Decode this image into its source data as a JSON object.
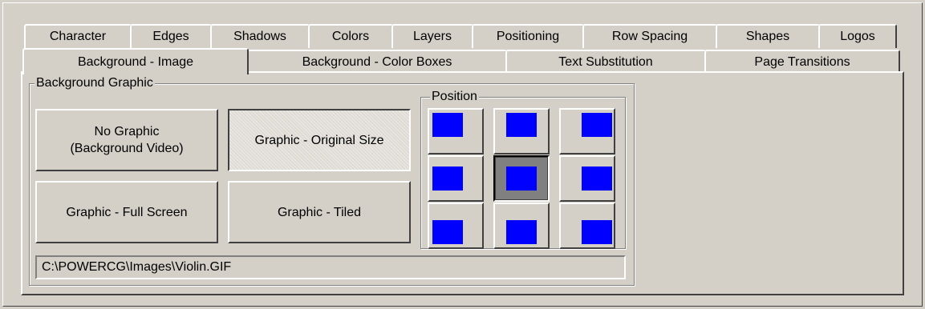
{
  "tabs_row1": [
    "Character",
    "Edges",
    "Shadows",
    "Colors",
    "Layers",
    "Positioning",
    "Row Spacing",
    "Shapes",
    "Logos"
  ],
  "tabs_row2": [
    "Background - Image",
    "Background - Color Boxes",
    "Text Substitution",
    "Page Transitions"
  ],
  "selected_tab": "Background - Image",
  "background_graphic": {
    "group_label": "Background Graphic",
    "buttons": {
      "no_graphic": "No Graphic\n(Background Video)",
      "original_size": "Graphic - Original Size",
      "full_screen": "Graphic - Full Screen",
      "tiled": "Graphic - Tiled"
    },
    "selected_button": "Graphic - Original Size",
    "file_path": "C:\\POWERCG\\Images\\Violin.GIF"
  },
  "position": {
    "group_label": "Position",
    "selected": "middle-center",
    "swatch_color": "#0000ff"
  }
}
